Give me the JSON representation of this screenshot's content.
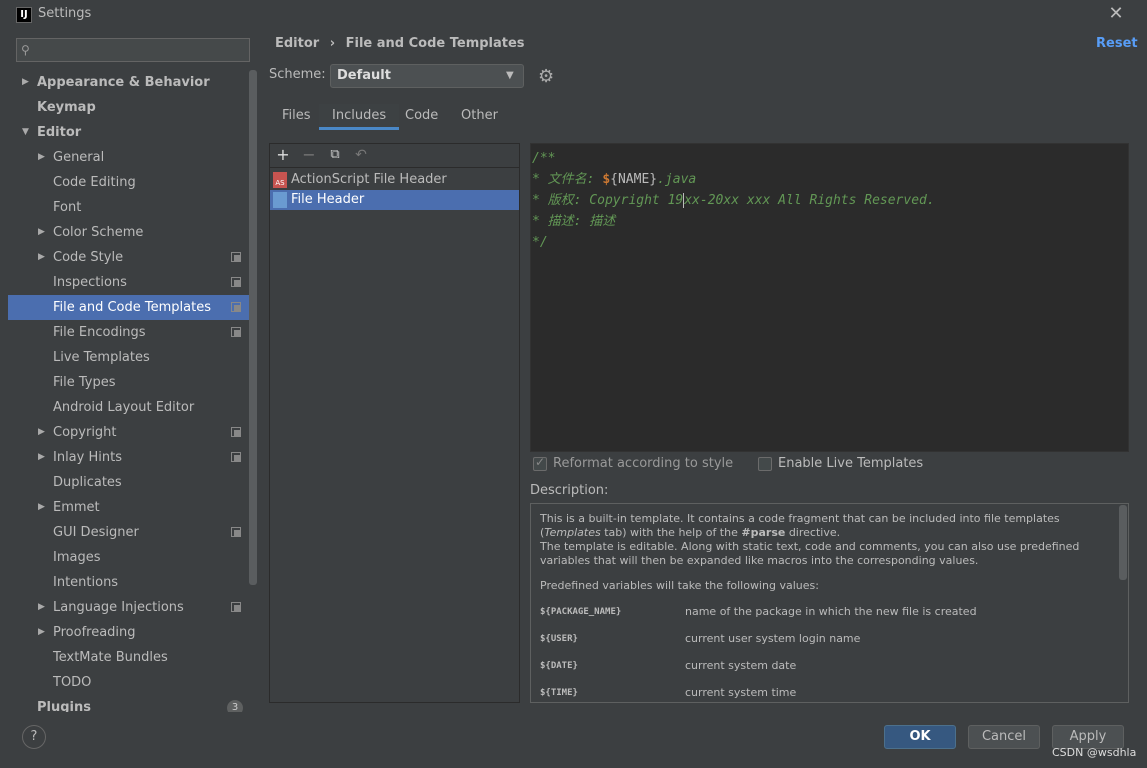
{
  "window": {
    "title": "Settings",
    "app_icon_text": "IJ"
  },
  "search": {
    "placeholder": ""
  },
  "sidebar": {
    "items": [
      {
        "label": "Appearance & Behavior"
      },
      {
        "label": "Keymap"
      },
      {
        "label": "Editor"
      },
      {
        "label": "General"
      },
      {
        "label": "Code Editing"
      },
      {
        "label": "Font"
      },
      {
        "label": "Color Scheme"
      },
      {
        "label": "Code Style"
      },
      {
        "label": "Inspections"
      },
      {
        "label": "File and Code Templates"
      },
      {
        "label": "File Encodings"
      },
      {
        "label": "Live Templates"
      },
      {
        "label": "File Types"
      },
      {
        "label": "Android Layout Editor"
      },
      {
        "label": "Copyright"
      },
      {
        "label": "Inlay Hints"
      },
      {
        "label": "Duplicates"
      },
      {
        "label": "Emmet"
      },
      {
        "label": "GUI Designer"
      },
      {
        "label": "Images"
      },
      {
        "label": "Intentions"
      },
      {
        "label": "Language Injections"
      },
      {
        "label": "Proofreading"
      },
      {
        "label": "TextMate Bundles"
      },
      {
        "label": "TODO"
      },
      {
        "label": "Plugins",
        "badge": "3"
      }
    ]
  },
  "header": {
    "breadcrumb_parent": "Editor",
    "breadcrumb_sep": "›",
    "breadcrumb_current": "File and Code Templates",
    "reset_label": "Reset"
  },
  "scheme": {
    "label": "Scheme:",
    "value": "Default"
  },
  "tabs": [
    {
      "label": "Files"
    },
    {
      "label": "Includes"
    },
    {
      "label": "Code"
    },
    {
      "label": "Other"
    }
  ],
  "templates": {
    "items": [
      {
        "label": "ActionScript File Header",
        "icon_text": "AS"
      },
      {
        "label": "File Header"
      }
    ]
  },
  "editor": {
    "line1": "/**",
    "line2_prefix": "* 文件名: ",
    "line2_dollar": "$",
    "line2_var": "{NAME}",
    "line2_suffix": ".java",
    "line3_a": "* 版权: Copyright 19",
    "line3_b": "xx-20xx xxx All Rights Reserved.",
    "line4": "* 描述: 描述",
    "line5": "*/"
  },
  "options": {
    "reformat_label": "Reformat according to style",
    "live_label": "Enable Live Templates"
  },
  "description": {
    "label": "Description:",
    "p1_a": "This is a built-in template. It contains a code fragment that can be included into file templates (",
    "p1_em": "Templates",
    "p1_b": " tab) with the help of the ",
    "p1_strong": "#parse",
    "p1_c": " directive.",
    "p2": "The template is editable. Along with static text, code and comments, you can also use predefined variables that will then be expanded like macros into the corresponding values.",
    "p3": "Predefined variables will take the following values:",
    "vars": [
      {
        "name": "${PACKAGE_NAME}",
        "desc": "name of the package in which the new file is created"
      },
      {
        "name": "${USER}",
        "desc": "current user system login name"
      },
      {
        "name": "${DATE}",
        "desc": "current system date"
      },
      {
        "name": "${TIME}",
        "desc": "current system time"
      }
    ]
  },
  "buttons": {
    "help": "?",
    "ok": "OK",
    "cancel": "Cancel",
    "apply": "Apply"
  },
  "watermark": "CSDN @wsdhla",
  "colors": {
    "selection": "#4b6eaf",
    "link": "#589df6",
    "comment": "#629755",
    "ok_button": "#365880"
  }
}
